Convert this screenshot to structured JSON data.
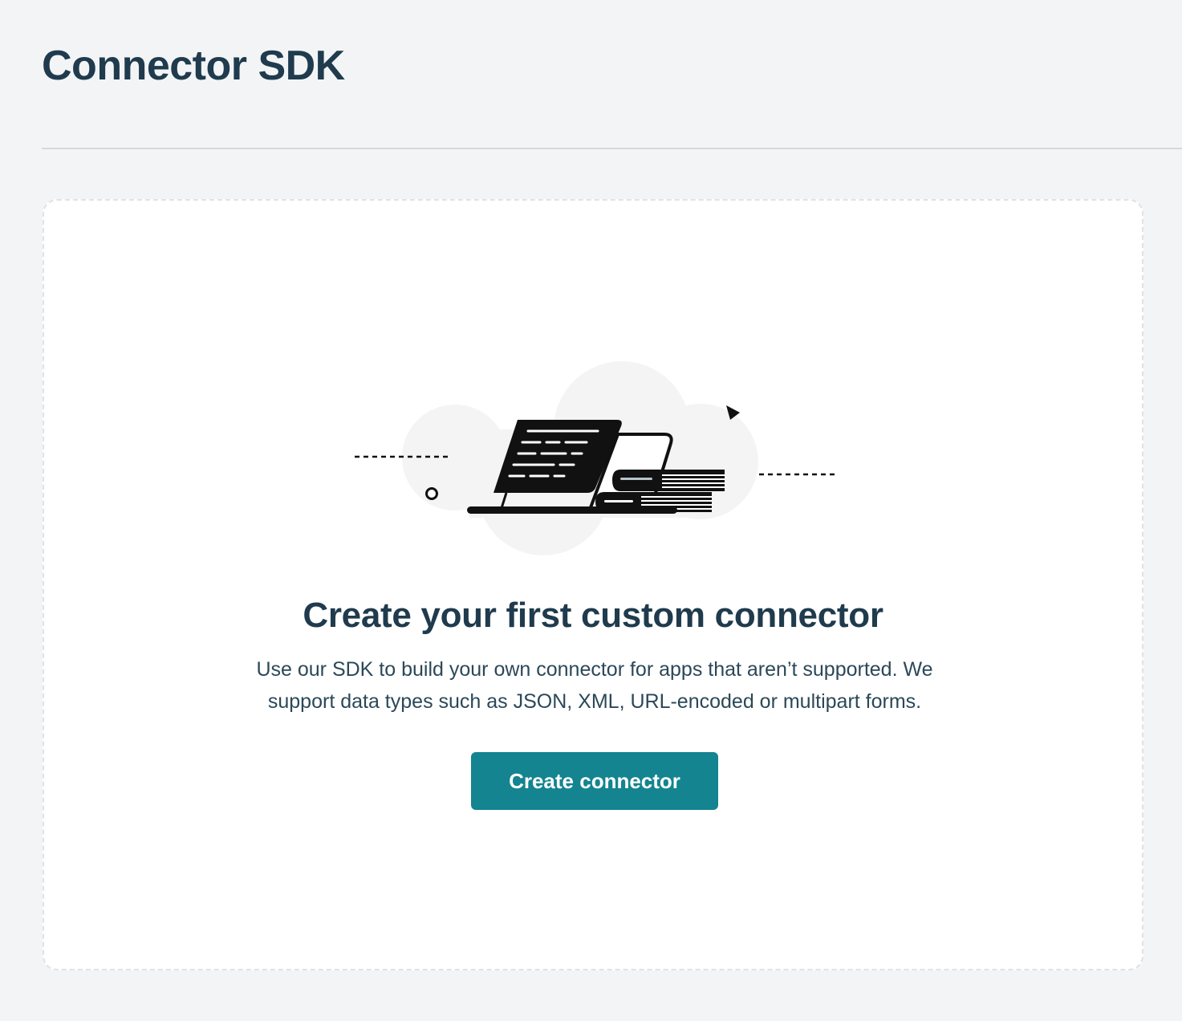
{
  "header": {
    "title": "Connector SDK"
  },
  "empty_state": {
    "illustration": "laptop-with-books-icon",
    "title": "Create your first custom connector",
    "description": "Use our SDK to build your own connector for apps that aren’t supported. We support data types such as JSON, XML, URL-encoded or multipart forms.",
    "button_label": "Create connector"
  },
  "colors": {
    "page_background": "#f3f4f6",
    "card_background": "#ffffff",
    "title_text": "#1f3b4d",
    "primary_button": "#138490",
    "illustration_blob": "#f4f4f4",
    "illustration_ink": "#111111"
  }
}
